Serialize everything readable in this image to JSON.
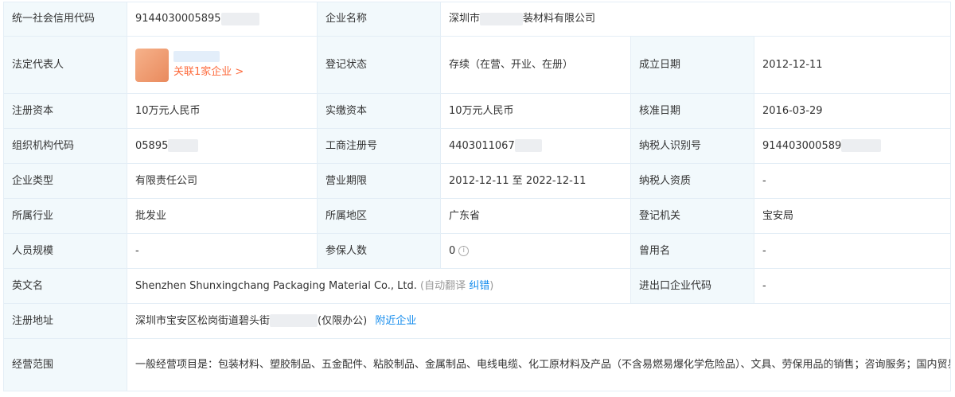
{
  "rows": {
    "r1": {
      "credit_code_label": "统一社会信用代码",
      "credit_code_value": "9144030005895",
      "company_name_label": "企业名称",
      "company_name_prefix": "深圳市",
      "company_name_suffix": "装材料有限公司"
    },
    "r2": {
      "legal_rep_label": "法定代表人",
      "related_link": "关联1家企业 >",
      "reg_status_label": "登记状态",
      "reg_status_value": "存续（在营、开业、在册）",
      "found_date_label": "成立日期",
      "found_date_value": "2012-12-11"
    },
    "r3": {
      "reg_capital_label": "注册资本",
      "reg_capital_value": "10万元人民币",
      "paid_capital_label": "实缴资本",
      "paid_capital_value": "10万元人民币",
      "approval_date_label": "核准日期",
      "approval_date_value": "2016-03-29"
    },
    "r4": {
      "org_code_label": "组织机构代码",
      "org_code_value": "05895",
      "biz_reg_label": "工商注册号",
      "biz_reg_value": "4403011067",
      "taxpayer_id_label": "纳税人识别号",
      "taxpayer_id_value": "914403000589"
    },
    "r5": {
      "company_type_label": "企业类型",
      "company_type_value": "有限责任公司",
      "biz_term_label": "营业期限",
      "biz_term_value": "2012-12-11 至 2022-12-11",
      "taxpayer_qual_label": "纳税人资质",
      "taxpayer_qual_value": "-"
    },
    "r6": {
      "industry_label": "所属行业",
      "industry_value": "批发业",
      "region_label": "所属地区",
      "region_value": "广东省",
      "reg_authority_label": "登记机关",
      "reg_authority_value": "宝安局"
    },
    "r7": {
      "staff_size_label": "人员规模",
      "staff_size_value": "-",
      "insured_label": "参保人数",
      "insured_value": "0",
      "former_name_label": "曾用名",
      "former_name_value": "-"
    },
    "r8": {
      "english_name_label": "英文名",
      "english_name_value": "Shenzhen Shunxingchang Packaging Material Co., Ltd.",
      "auto_translate": "(自动翻译",
      "correct_link": "纠错",
      "close_paren": ")",
      "import_export_label": "进出口企业代码",
      "import_export_value": "-"
    },
    "r9": {
      "address_label": "注册地址",
      "address_prefix": "深圳市宝安区松岗街道碧头街",
      "address_suffix": "(仅限办公)",
      "nearby_link": "附近企业"
    },
    "r10": {
      "scope_label": "经营范围",
      "scope_value": "一般经营项目是：包装材料、塑胶制品、五金配件、粘胶制品、金属制品、电线电缆、化工原材料及产品（不含易燃易爆化学危险品）、文具、劳保用品的销售；咨询服务；国内贸易。（法律、行政法规、国务院决定规定在登记前须经批准的除外），许可经营项目是："
    }
  },
  "colors": {
    "label_bg": "#f2f9fc",
    "border": "#e4eef6",
    "link_blue": "#128bed",
    "link_orange": "#fd6b3d"
  }
}
